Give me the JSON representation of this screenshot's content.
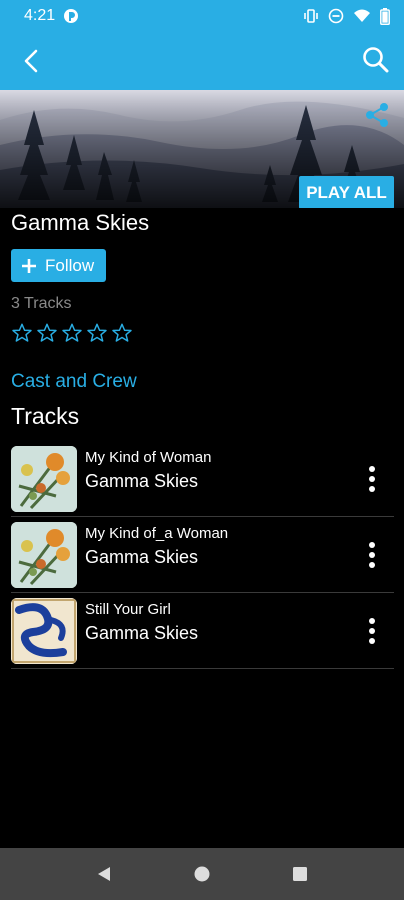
{
  "status_bar": {
    "time": "4:21",
    "icons": [
      "notification-icon",
      "vibrate-icon",
      "dnd-icon",
      "wifi-icon",
      "battery-icon"
    ]
  },
  "app_bar": {
    "icons": [
      "back-arrow-icon",
      "search-icon"
    ],
    "background": "#29aee4"
  },
  "hero": {
    "share_icon": "share-icon",
    "play_all_label": "PLAY ALL"
  },
  "artist": {
    "name": "Gamma Skies",
    "follow_label": "Follow",
    "track_count": "3 Tracks",
    "rating": {
      "filled": 0,
      "max": 5
    }
  },
  "cast_link": "Cast and Crew",
  "tracks_heading": "Tracks",
  "tracks": [
    {
      "title": "My Kind of Woman",
      "artist": "Gamma Skies",
      "art": "flowers"
    },
    {
      "title": "My Kind of_a Woman",
      "artist": "Gamma Skies",
      "art": "flowers"
    },
    {
      "title": "Still Your Girl",
      "artist": "Gamma Skies",
      "art": "ribbon"
    }
  ],
  "nav_bar": {
    "icons": [
      "back-nav-icon",
      "home-nav-icon",
      "recents-nav-icon"
    ]
  },
  "colors": {
    "accent": "#29aee4",
    "background": "#000000",
    "muted_text": "#8a8a8a",
    "nav_bar": "#444444"
  }
}
